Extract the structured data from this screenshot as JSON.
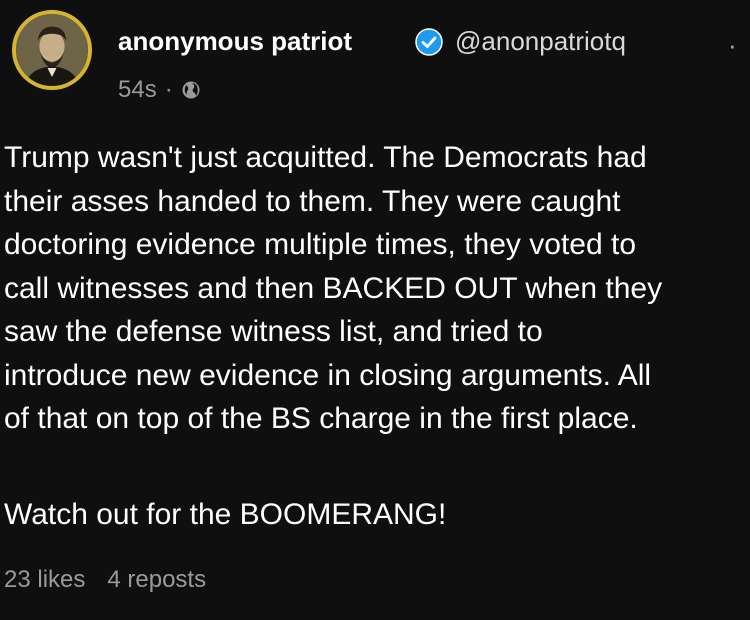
{
  "author": {
    "display_name": "anonymous patriot",
    "handle": "@anonpatriotq",
    "timestamp": "54s",
    "separator": "·",
    "avatar_icon": "portrait-avatar",
    "verified_color": "#1d9bf0",
    "avatar_border_color": "#d6b52e"
  },
  "menu": {
    "icon": "more-dot-icon",
    "glyph": "·"
  },
  "post": {
    "lines": [
      "Trump wasn't just acquitted. The Democrats had",
      "their asses handed to them. They were caught",
      "doctoring evidence multiple times, they voted to",
      "call witnesses and then BACKED OUT when they",
      "saw the defense witness list, and tried to",
      "introduce new evidence in closing arguments. All",
      "of that on top of the BS charge in the first place."
    ],
    "closing": "Watch out for the BOOMERANG!"
  },
  "stats": {
    "likes": "23 likes",
    "reposts": "4 reposts"
  }
}
